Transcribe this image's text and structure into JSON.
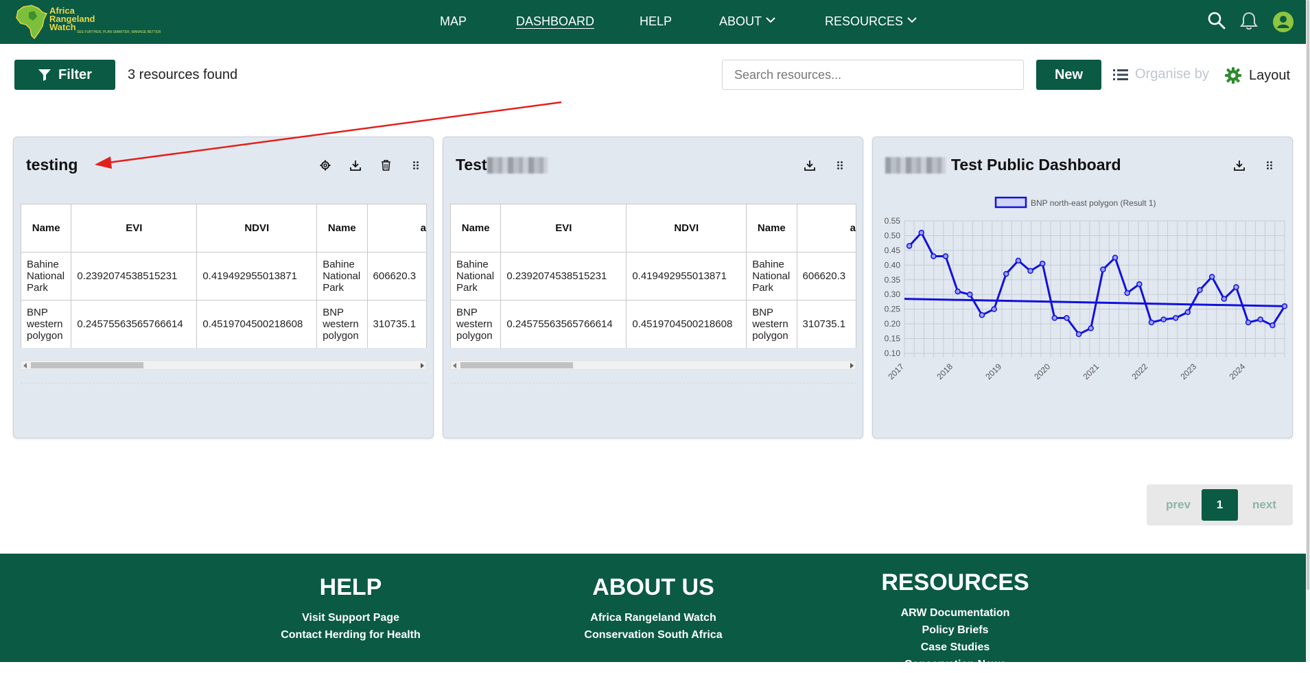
{
  "nav": {
    "logo_line1": "Africa",
    "logo_line2": "Rangeland",
    "logo_line3": "Watch",
    "logo_tag": "SEE FURTHER, PLAN SMARTER, MANAGE BETTER",
    "links": [
      "MAP",
      "DASHBOARD",
      "HELP",
      "ABOUT",
      "RESOURCES"
    ],
    "active": "DASHBOARD"
  },
  "toolbar": {
    "filter_label": "Filter",
    "resources_found": "3 resources found",
    "search_placeholder": "Search resources...",
    "new_label": "New",
    "organise_label": "Organise by",
    "layout_label": "Layout"
  },
  "cards": [
    {
      "title": "testing",
      "icons": [
        "settings-icon",
        "download-icon",
        "delete-icon",
        "drag-handle-icon"
      ],
      "table": {
        "headers": [
          "Name",
          "EVI",
          "NDVI",
          "Name",
          "a"
        ],
        "rows": [
          [
            "Bahine National Park",
            "0.2392074538515231",
            "0.419492955013871",
            "Bahine National Park",
            "606620.3"
          ],
          [
            "BNP western polygon",
            "0.24575563565766614",
            "0.4519704500218608",
            "BNP western polygon",
            "310735.1"
          ]
        ]
      }
    },
    {
      "title": "Test",
      "icons": [
        "download-icon",
        "drag-handle-icon"
      ],
      "table": {
        "headers": [
          "Name",
          "EVI",
          "NDVI",
          "Name",
          "a"
        ],
        "rows": [
          [
            "Bahine National Park",
            "0.2392074538515231",
            "0.419492955013871",
            "Bahine National Park",
            "606620.3"
          ],
          [
            "BNP western polygon",
            "0.24575563565766614",
            "0.4519704500218608",
            "BNP western polygon",
            "310735.1"
          ]
        ]
      }
    },
    {
      "title": "Test Public Dashboard",
      "icons": [
        "download-icon",
        "drag-handle-icon"
      ]
    }
  ],
  "chart_data": {
    "type": "line",
    "legend": "BNP north-east polygon (Result 1)",
    "color": "#1111dd",
    "x_ticks": [
      "2017",
      "2018",
      "2019",
      "2020",
      "2021",
      "2022",
      "2023",
      "2024"
    ],
    "y_ticks": [
      "0.55",
      "0.50",
      "0.45",
      "0.40",
      "0.35",
      "0.30",
      "0.25",
      "0.20",
      "0.15",
      "0.10"
    ],
    "ylim": [
      0.1,
      0.55
    ],
    "xlim": [
      2017.0,
      2024.8
    ],
    "grid": true,
    "series_x": [
      2017.0,
      2017.2,
      2017.4,
      2017.6,
      2017.8,
      2018.0,
      2018.2,
      2018.4,
      2018.6,
      2018.8,
      2019.0,
      2019.2,
      2019.4,
      2019.6,
      2019.8,
      2020.0,
      2020.2,
      2020.4,
      2020.6,
      2020.8,
      2021.0,
      2021.2,
      2021.4,
      2021.6,
      2021.8,
      2022.0,
      2022.2,
      2022.4,
      2022.6,
      2022.8,
      2023.0,
      2023.2,
      2023.4,
      2023.6,
      2023.8,
      2024.0,
      2024.2,
      2024.4,
      2024.6,
      2024.8
    ],
    "series_y": [
      0.465,
      0.51,
      0.43,
      0.43,
      0.31,
      0.3,
      0.23,
      0.25,
      0.37,
      0.415,
      0.38,
      0.405,
      0.22,
      0.22,
      0.165,
      0.185,
      0.385,
      0.425,
      0.305,
      0.335,
      0.205,
      0.215,
      0.22,
      0.24,
      0.315,
      0.36,
      0.285,
      0.325,
      0.205,
      0.215,
      0.195,
      0.26
    ],
    "trend": [
      [
        2017.0,
        0.285
      ],
      [
        2024.8,
        0.26
      ]
    ]
  },
  "pagination": {
    "prev": "prev",
    "current": "1",
    "next": "next"
  },
  "footer": {
    "help": {
      "title": "HELP",
      "links": [
        "Visit Support Page",
        "Contact Herding for Health"
      ]
    },
    "about": {
      "title": "ABOUT US",
      "links": [
        "Africa Rangeland Watch",
        "Conservation South Africa"
      ]
    },
    "resources": {
      "title": "RESOURCES",
      "links": [
        "ARW Documentation",
        "Policy Briefs",
        "Case Studies",
        "Conservation News"
      ]
    }
  }
}
